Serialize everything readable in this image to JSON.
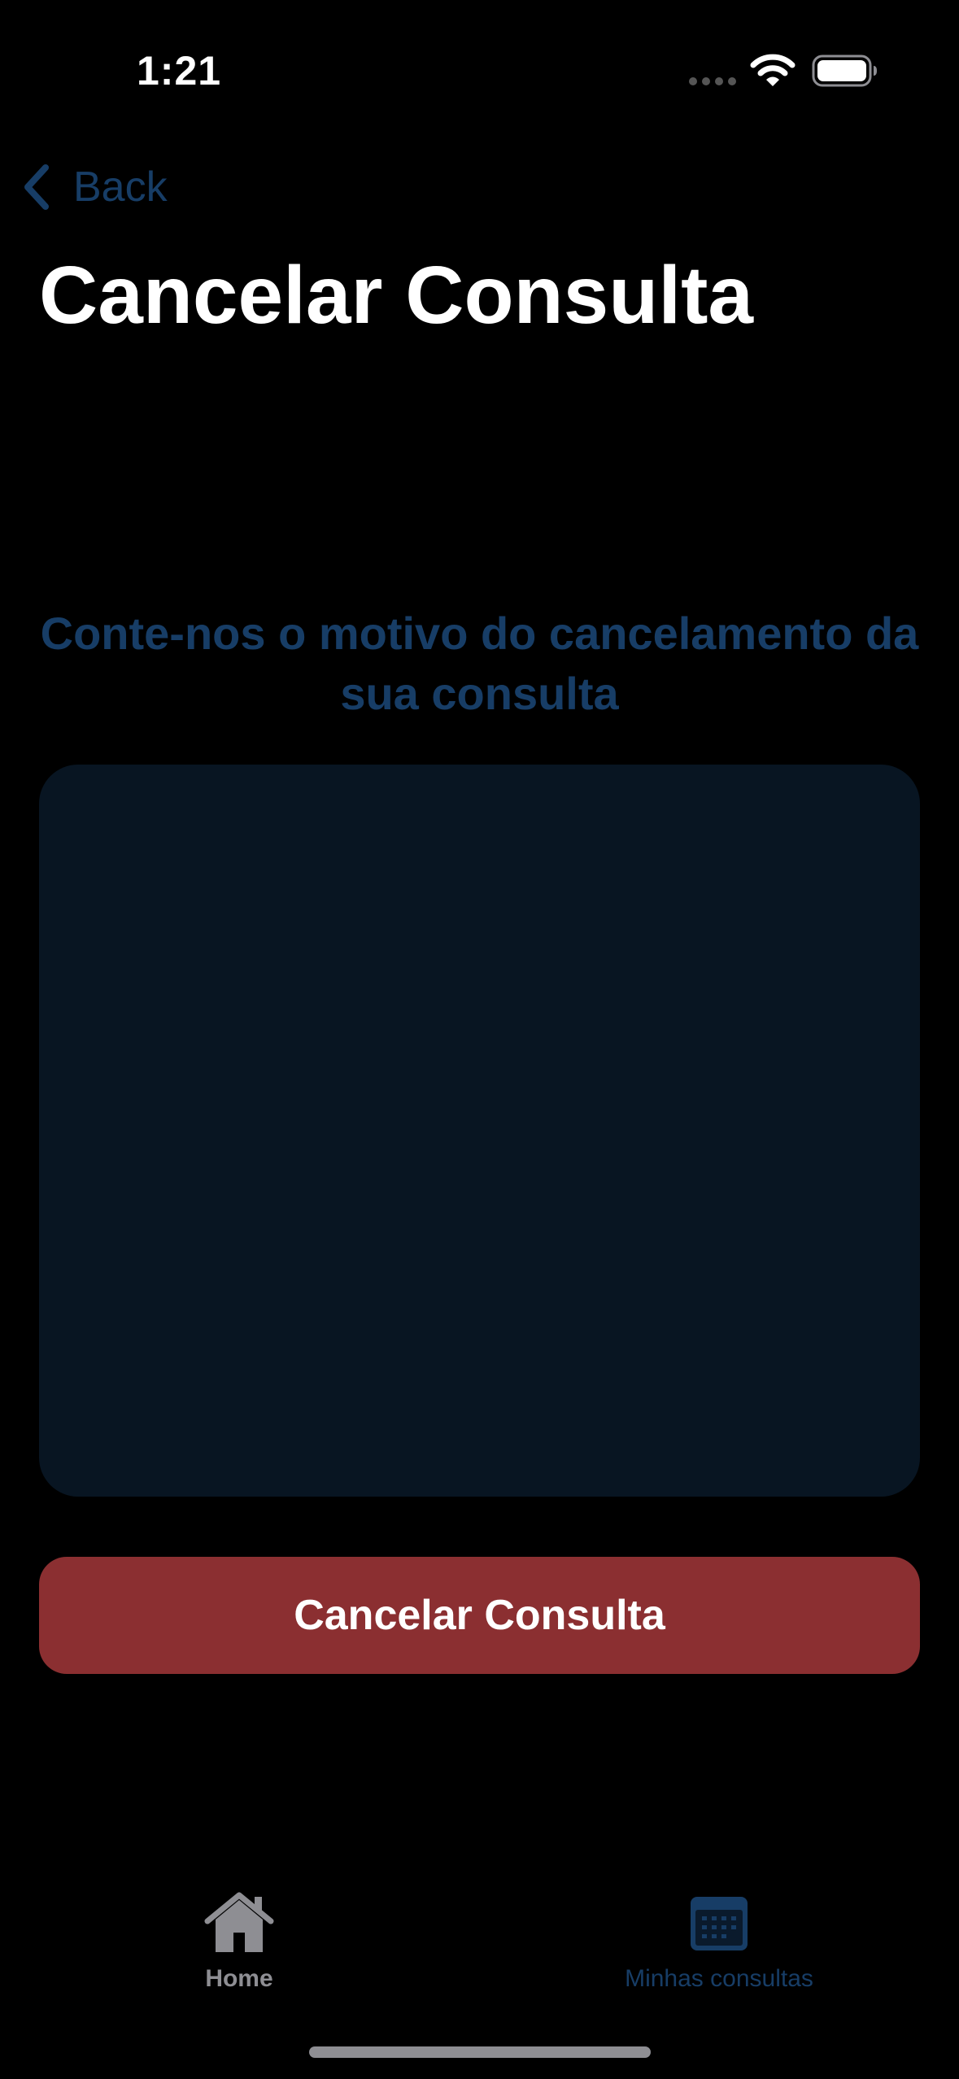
{
  "status_bar": {
    "time": "1:21"
  },
  "navigation": {
    "back_label": "Back",
    "title": "Cancelar Consulta"
  },
  "form": {
    "prompt": "Conte-nos o motivo do cancelamento da sua consulta",
    "reason_value": "",
    "submit_label": "Cancelar Consulta"
  },
  "tab_bar": {
    "items": [
      {
        "label": "Home",
        "icon": "house-icon",
        "selected": false
      },
      {
        "label": "Minhas consultas",
        "icon": "calendar-icon",
        "selected": true
      }
    ]
  },
  "colors": {
    "accent": "#173d66",
    "destructive": "#8b2f31",
    "field_background": "#081522",
    "background": "#000000",
    "inactive_tab": "#8e8e93"
  }
}
